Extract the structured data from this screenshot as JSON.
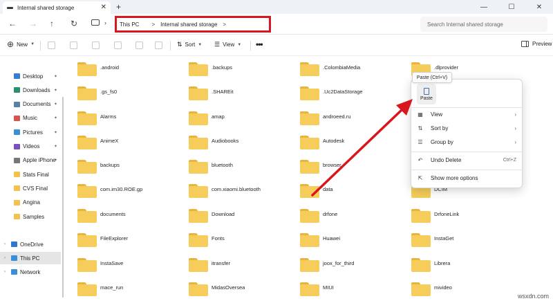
{
  "titlebar": {
    "tab_title": "Internal shared storage",
    "tab_close": "✕",
    "new_tab": "+",
    "minimize": "—",
    "maximize": "☐",
    "close": "✕"
  },
  "nav": {
    "back": "←",
    "forward": "→",
    "up": "↑",
    "refresh": "↻",
    "chevron": "›",
    "breadcrumb": [
      "This PC",
      "Internal shared storage"
    ],
    "breadcrumb_sep": ">",
    "search_placeholder": "Search Internal shared storage"
  },
  "toolbar": {
    "new_label": "New",
    "sort_label": "Sort",
    "view_label": "View",
    "more": "•••",
    "preview_label": "Preview"
  },
  "sidebar": {
    "quick_access": [
      {
        "label": "Desktop",
        "icon": "desktop-icon",
        "color": "#3a7bd5"
      },
      {
        "label": "Downloads",
        "icon": "download-icon",
        "color": "#2b8f6b"
      },
      {
        "label": "Documents",
        "icon": "document-icon",
        "color": "#5a7fa8"
      },
      {
        "label": "Music",
        "icon": "music-icon",
        "color": "#d9534f"
      },
      {
        "label": "Pictures",
        "icon": "picture-icon",
        "color": "#3b8fd8"
      },
      {
        "label": "Videos",
        "icon": "video-icon",
        "color": "#7b4fc4"
      },
      {
        "label": "Apple iPhone",
        "icon": "phone-icon",
        "color": "#777777"
      },
      {
        "label": "Stats Final",
        "icon": "folder-icon",
        "color": "#f2c14e"
      },
      {
        "label": "CVS Final",
        "icon": "folder-icon",
        "color": "#f2c14e"
      },
      {
        "label": "Angina",
        "icon": "folder-icon",
        "color": "#f2c14e"
      },
      {
        "label": "Samples",
        "icon": "folder-icon",
        "color": "#f2c14e"
      }
    ],
    "roots": [
      {
        "label": "OneDrive",
        "icon": "cloud-icon",
        "color": "#2f78d0"
      },
      {
        "label": "This PC",
        "icon": "computer-icon",
        "color": "#3a8fd8"
      },
      {
        "label": "Network",
        "icon": "network-icon",
        "color": "#3a8fd8"
      }
    ],
    "pin": "✦",
    "expand": "›"
  },
  "files": [
    [
      ".android",
      ".backups",
      ".ColombiaMedia",
      ".dlprovider"
    ],
    [
      ".gs_fs0",
      ".SHAREit",
      ".Uc2DataStorage",
      ""
    ],
    [
      "Alarms",
      "amap",
      "androeed.ru",
      ""
    ],
    [
      "AnimeX",
      "Audiobooks",
      "Autodesk",
      ""
    ],
    [
      "backups",
      "bluetooth",
      "browser",
      ""
    ],
    [
      "com.im30.ROE.gp",
      "com.xiaomi.bluetooth",
      "data",
      "DCIM"
    ],
    [
      "documents",
      "Download",
      "drfone",
      "DrfoneLink"
    ],
    [
      "FileExplorer",
      "Fonts",
      "Huawei",
      "InstaGet"
    ],
    [
      "InstaSave",
      "itransfer",
      "joox_for_third",
      "Librera"
    ],
    [
      "mace_run",
      "MidasOversea",
      "MIUI",
      "mivideo"
    ]
  ],
  "context_menu": {
    "tooltip": "Paste (Ctrl+V)",
    "paste_label": "Paste",
    "items": [
      {
        "label": "View",
        "icon": "▦",
        "icon_name": "view-icon",
        "arrow": "›",
        "shortcut": ""
      },
      {
        "label": "Sort by",
        "icon": "⇅",
        "icon_name": "sort-icon",
        "arrow": "›",
        "shortcut": ""
      },
      {
        "label": "Group by",
        "icon": "☰",
        "icon_name": "group-icon",
        "arrow": "›",
        "shortcut": ""
      },
      {
        "label": "Undo Delete",
        "icon": "↶",
        "icon_name": "undo-icon",
        "arrow": "",
        "shortcut": "Ctrl+Z"
      },
      {
        "label": "Show more options",
        "icon": "⇱",
        "icon_name": "more-options-icon",
        "arrow": "",
        "shortcut": ""
      }
    ]
  },
  "annotation_color": "#d7161d",
  "watermark": "wsxdn.com"
}
